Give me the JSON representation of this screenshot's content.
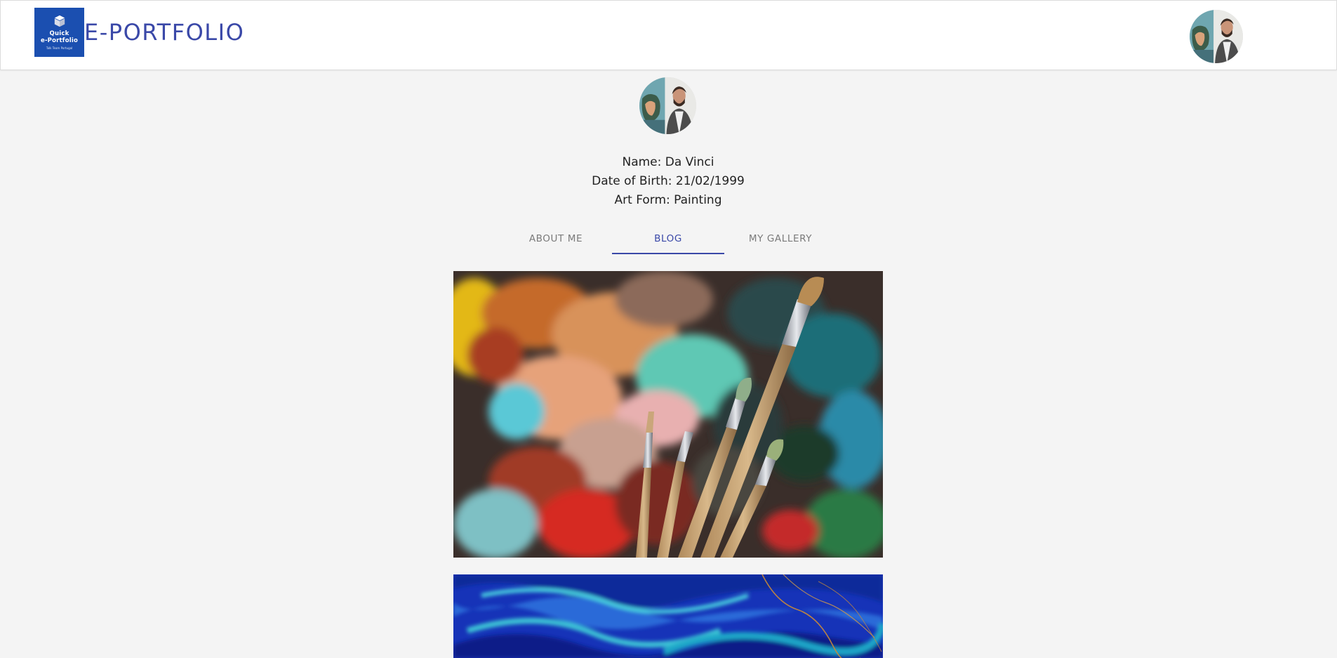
{
  "header": {
    "logo": {
      "line1": "Quick",
      "line2": "e-Portfolio",
      "line3": "Talk Team Portugal",
      "icon": "cube-stack-icon"
    },
    "title": "E-PORTFOLIO",
    "account_avatar_icon": "user-avatar"
  },
  "profile": {
    "name_line": "Name: Da Vinci",
    "dob_line": "Date of Birth: 21/02/1999",
    "artform_line": "Art Form: Painting"
  },
  "tabs": [
    {
      "label": "ABOUT ME",
      "active": false
    },
    {
      "label": "BLOG",
      "active": true
    },
    {
      "label": "MY GALLERY",
      "active": false
    }
  ],
  "blog": {
    "posts": [
      {
        "image": "oil-paint-palette-with-brushes"
      },
      {
        "image": "blue-fluid-marble-art"
      }
    ]
  },
  "colors": {
    "accent": "#3a48a8",
    "logo_bg": "#1b4fb0",
    "page_bg": "#f4f4f4",
    "header_bg": "#ffffff",
    "tab_inactive": "#7a7a7a"
  }
}
